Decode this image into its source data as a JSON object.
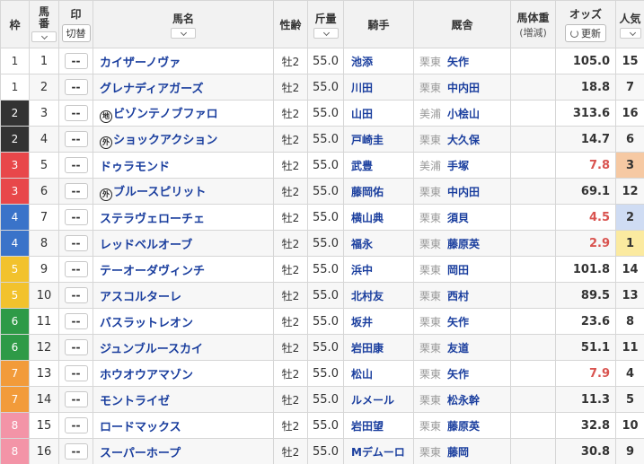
{
  "header": {
    "waku": "枠",
    "umaban": "馬番",
    "mark": "印",
    "mark_btn": "切替",
    "horse": "馬名",
    "sex_age": "性齢",
    "weight": "斤量",
    "jockey": "騎手",
    "trainer": "厩舎",
    "body_weight": "馬体重",
    "body_weight_sub": "(増減)",
    "odds": "オッズ",
    "refresh": "更新",
    "pop": "人気"
  },
  "colors": {
    "waku": [
      "#ffffff",
      "#ffffff",
      "#333333",
      "#333333",
      "#e8474a",
      "#e8474a",
      "#3a73c9",
      "#3a73c9",
      "#f2c22d",
      "#f2c22d",
      "#2e9a47",
      "#2e9a47",
      "#f29b3a",
      "#f29b3a",
      "#f394a7",
      "#f394a7"
    ]
  },
  "rows": [
    {
      "waku": "1",
      "umaban": "1",
      "mark": "--",
      "prefix": "",
      "horse": "カイザーノヴァ",
      "sex_age": "牡2",
      "weight": "55.0",
      "jockey": "池添",
      "region": "栗東",
      "trainer": "矢作",
      "body_weight": "",
      "odds": "105.0",
      "pop": "15",
      "hot": false,
      "popbg": ""
    },
    {
      "waku": "1",
      "umaban": "2",
      "mark": "--",
      "prefix": "",
      "horse": "グレナディアガーズ",
      "sex_age": "牡2",
      "weight": "55.0",
      "jockey": "川田",
      "region": "栗東",
      "trainer": "中内田",
      "body_weight": "",
      "odds": "18.8",
      "pop": "7",
      "hot": false,
      "popbg": ""
    },
    {
      "waku": "2",
      "umaban": "3",
      "mark": "--",
      "prefix": "地",
      "horse": "ビゾンテノブファロ",
      "sex_age": "牡2",
      "weight": "55.0",
      "jockey": "山田",
      "region": "美浦",
      "trainer": "小桧山",
      "body_weight": "",
      "odds": "313.6",
      "pop": "16",
      "hot": false,
      "popbg": ""
    },
    {
      "waku": "2",
      "umaban": "4",
      "mark": "--",
      "prefix": "外",
      "horse": "ショックアクション",
      "sex_age": "牡2",
      "weight": "55.0",
      "jockey": "戸崎圭",
      "region": "栗東",
      "trainer": "大久保",
      "body_weight": "",
      "odds": "14.7",
      "pop": "6",
      "hot": false,
      "popbg": ""
    },
    {
      "waku": "3",
      "umaban": "5",
      "mark": "--",
      "prefix": "",
      "horse": "ドゥラモンド",
      "sex_age": "牡2",
      "weight": "55.0",
      "jockey": "武豊",
      "region": "美浦",
      "trainer": "手塚",
      "body_weight": "",
      "odds": "7.8",
      "pop": "3",
      "hot": true,
      "popbg": "#f6c9a3"
    },
    {
      "waku": "3",
      "umaban": "6",
      "mark": "--",
      "prefix": "外",
      "horse": "ブルースピリット",
      "sex_age": "牡2",
      "weight": "55.0",
      "jockey": "藤岡佑",
      "region": "栗東",
      "trainer": "中内田",
      "body_weight": "",
      "odds": "69.1",
      "pop": "12",
      "hot": false,
      "popbg": ""
    },
    {
      "waku": "4",
      "umaban": "7",
      "mark": "--",
      "prefix": "",
      "horse": "ステラヴェローチェ",
      "sex_age": "牡2",
      "weight": "55.0",
      "jockey": "横山典",
      "region": "栗東",
      "trainer": "須貝",
      "body_weight": "",
      "odds": "4.5",
      "pop": "2",
      "hot": true,
      "popbg": "#cfdcf3"
    },
    {
      "waku": "4",
      "umaban": "8",
      "mark": "--",
      "prefix": "",
      "horse": "レッドベルオーブ",
      "sex_age": "牡2",
      "weight": "55.0",
      "jockey": "福永",
      "region": "栗東",
      "trainer": "藤原英",
      "body_weight": "",
      "odds": "2.9",
      "pop": "1",
      "hot": true,
      "popbg": "#fbeaa0"
    },
    {
      "waku": "5",
      "umaban": "9",
      "mark": "--",
      "prefix": "",
      "horse": "テーオーダヴィンチ",
      "sex_age": "牡2",
      "weight": "55.0",
      "jockey": "浜中",
      "region": "栗東",
      "trainer": "岡田",
      "body_weight": "",
      "odds": "101.8",
      "pop": "14",
      "hot": false,
      "popbg": ""
    },
    {
      "waku": "5",
      "umaban": "10",
      "mark": "--",
      "prefix": "",
      "horse": "アスコルターレ",
      "sex_age": "牡2",
      "weight": "55.0",
      "jockey": "北村友",
      "region": "栗東",
      "trainer": "西村",
      "body_weight": "",
      "odds": "89.5",
      "pop": "13",
      "hot": false,
      "popbg": ""
    },
    {
      "waku": "6",
      "umaban": "11",
      "mark": "--",
      "prefix": "",
      "horse": "バスラットレオン",
      "sex_age": "牡2",
      "weight": "55.0",
      "jockey": "坂井",
      "region": "栗東",
      "trainer": "矢作",
      "body_weight": "",
      "odds": "23.6",
      "pop": "8",
      "hot": false,
      "popbg": ""
    },
    {
      "waku": "6",
      "umaban": "12",
      "mark": "--",
      "prefix": "",
      "horse": "ジュンブルースカイ",
      "sex_age": "牡2",
      "weight": "55.0",
      "jockey": "岩田康",
      "region": "栗東",
      "trainer": "友道",
      "body_weight": "",
      "odds": "51.1",
      "pop": "11",
      "hot": false,
      "popbg": ""
    },
    {
      "waku": "7",
      "umaban": "13",
      "mark": "--",
      "prefix": "",
      "horse": "ホウオウアマゾン",
      "sex_age": "牡2",
      "weight": "55.0",
      "jockey": "松山",
      "region": "栗東",
      "trainer": "矢作",
      "body_weight": "",
      "odds": "7.9",
      "pop": "4",
      "hot": true,
      "popbg": ""
    },
    {
      "waku": "7",
      "umaban": "14",
      "mark": "--",
      "prefix": "",
      "horse": "モントライゼ",
      "sex_age": "牡2",
      "weight": "55.0",
      "jockey": "ルメール",
      "region": "栗東",
      "trainer": "松永幹",
      "body_weight": "",
      "odds": "11.3",
      "pop": "5",
      "hot": false,
      "popbg": ""
    },
    {
      "waku": "8",
      "umaban": "15",
      "mark": "--",
      "prefix": "",
      "horse": "ロードマックス",
      "sex_age": "牡2",
      "weight": "55.0",
      "jockey": "岩田望",
      "region": "栗東",
      "trainer": "藤原英",
      "body_weight": "",
      "odds": "32.8",
      "pop": "10",
      "hot": false,
      "popbg": ""
    },
    {
      "waku": "8",
      "umaban": "16",
      "mark": "--",
      "prefix": "",
      "horse": "スーパーホープ",
      "sex_age": "牡2",
      "weight": "55.0",
      "jockey": "Mデムーロ",
      "region": "栗東",
      "trainer": "藤岡",
      "body_weight": "",
      "odds": "30.8",
      "pop": "9",
      "hot": false,
      "popbg": ""
    }
  ]
}
